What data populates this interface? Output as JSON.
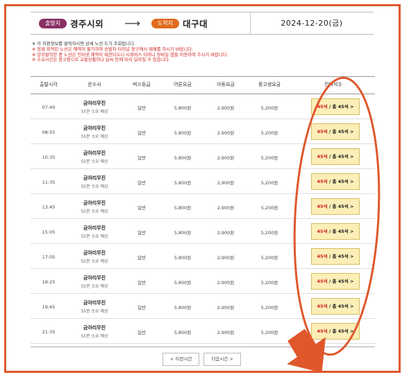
{
  "route": {
    "departure_badge": "출발지",
    "departure_city": "경주시외",
    "arrow": "⟶",
    "arrival_badge": "도착지",
    "arrival_city": "대구대",
    "date": "2024-12-20(금)"
  },
  "notes": [
    {
      "text": "※ 각 차편정보를 클릭하시면 상세 노선 도가 조회됩니다.",
      "color": "gray"
    },
    {
      "text": "※ 정제 최적된 노선은 예약이 불가하며 승발차 터미널 창구에서 매매를 하시기 바랍니다.",
      "color": "red"
    },
    {
      "text": "※ 당지발의한 중 노선은 인터넷 예약이 제한되오니 시외버스 터미나 창바일 앱을 이용하여 주시기 바랍니다.",
      "color": "red"
    },
    {
      "text": "※ 소요시간은 참고용으로 교통상황이나 날씨 등에 따라 달라질 수 있습니다.",
      "color": "red"
    }
  ],
  "table": {
    "headers": [
      "출발시각",
      "운수사",
      "버스등급",
      "어른요금",
      "아동요금",
      "중고생요금",
      "잔여석수"
    ],
    "rows": [
      {
        "time": "07:40",
        "company": "금아리무진",
        "duration": "55분 소요 예상",
        "grade": "일반",
        "adult": "5,800원",
        "child": "2,900원",
        "student": "5,200원",
        "remain": "45석",
        "total": "/ 총 45석 >"
      },
      {
        "time": "08:55",
        "company": "금아리무진",
        "duration": "55분 소요 예상",
        "grade": "일반",
        "adult": "5,800원",
        "child": "2,900원",
        "student": "5,200원",
        "remain": "45석",
        "total": "/ 총 45석 >"
      },
      {
        "time": "10:35",
        "company": "금아리무진",
        "duration": "55분 소요 예상",
        "grade": "일반",
        "adult": "5,800원",
        "child": "2,900원",
        "student": "5,200원",
        "remain": "45석",
        "total": "/ 총 45석 >"
      },
      {
        "time": "11:35",
        "company": "금아리무진",
        "duration": "55분 소요 예상",
        "grade": "일반",
        "adult": "5,800원",
        "child": "2,900원",
        "student": "5,200원",
        "remain": "45석",
        "total": "/ 총 45석 >"
      },
      {
        "time": "13:45",
        "company": "금아리무진",
        "duration": "55분 소요 예상",
        "grade": "일반",
        "adult": "5,800원",
        "child": "2,900원",
        "student": "5,200원",
        "remain": "45석",
        "total": "/ 총 45석 >"
      },
      {
        "time": "15:05",
        "company": "금아리무진",
        "duration": "55분 소요 예상",
        "grade": "일반",
        "adult": "5,800원",
        "child": "2,900원",
        "student": "5,200원",
        "remain": "45석",
        "total": "/ 총 45석 >"
      },
      {
        "time": "17:05",
        "company": "금아리무진",
        "duration": "55분 소요 예상",
        "grade": "일반",
        "adult": "5,800원",
        "child": "2,900원",
        "student": "5,200원",
        "remain": "45석",
        "total": "/ 총 45석 >"
      },
      {
        "time": "18:25",
        "company": "금아리무진",
        "duration": "55분 소요 예상",
        "grade": "일반",
        "adult": "5,800원",
        "child": "2,900원",
        "student": "5,200원",
        "remain": "45석",
        "total": "/ 총 45석 >"
      },
      {
        "time": "19:45",
        "company": "금아리무진",
        "duration": "55분 소요 예상",
        "grade": "일반",
        "adult": "5,800원",
        "child": "2,900원",
        "student": "5,200원",
        "remain": "45석",
        "total": "/ 총 45석 >"
      },
      {
        "time": "21:35",
        "company": "금아리무진",
        "duration": "55분 소요 예상",
        "grade": "일반",
        "adult": "5,800원",
        "child": "2,900원",
        "student": "5,200원",
        "remain": "45석",
        "total": "/ 총 45석 >"
      }
    ]
  },
  "pager": {
    "prev": "< 이전시간",
    "next": "다음시간 >"
  },
  "colors": {
    "annotation": "#e0572b",
    "departure_badge": "#8a2f63",
    "arrival_badge": "#e06b1e",
    "seat_button": "#fbeeb6",
    "remaining_seat_text": "#d21e1e"
  }
}
